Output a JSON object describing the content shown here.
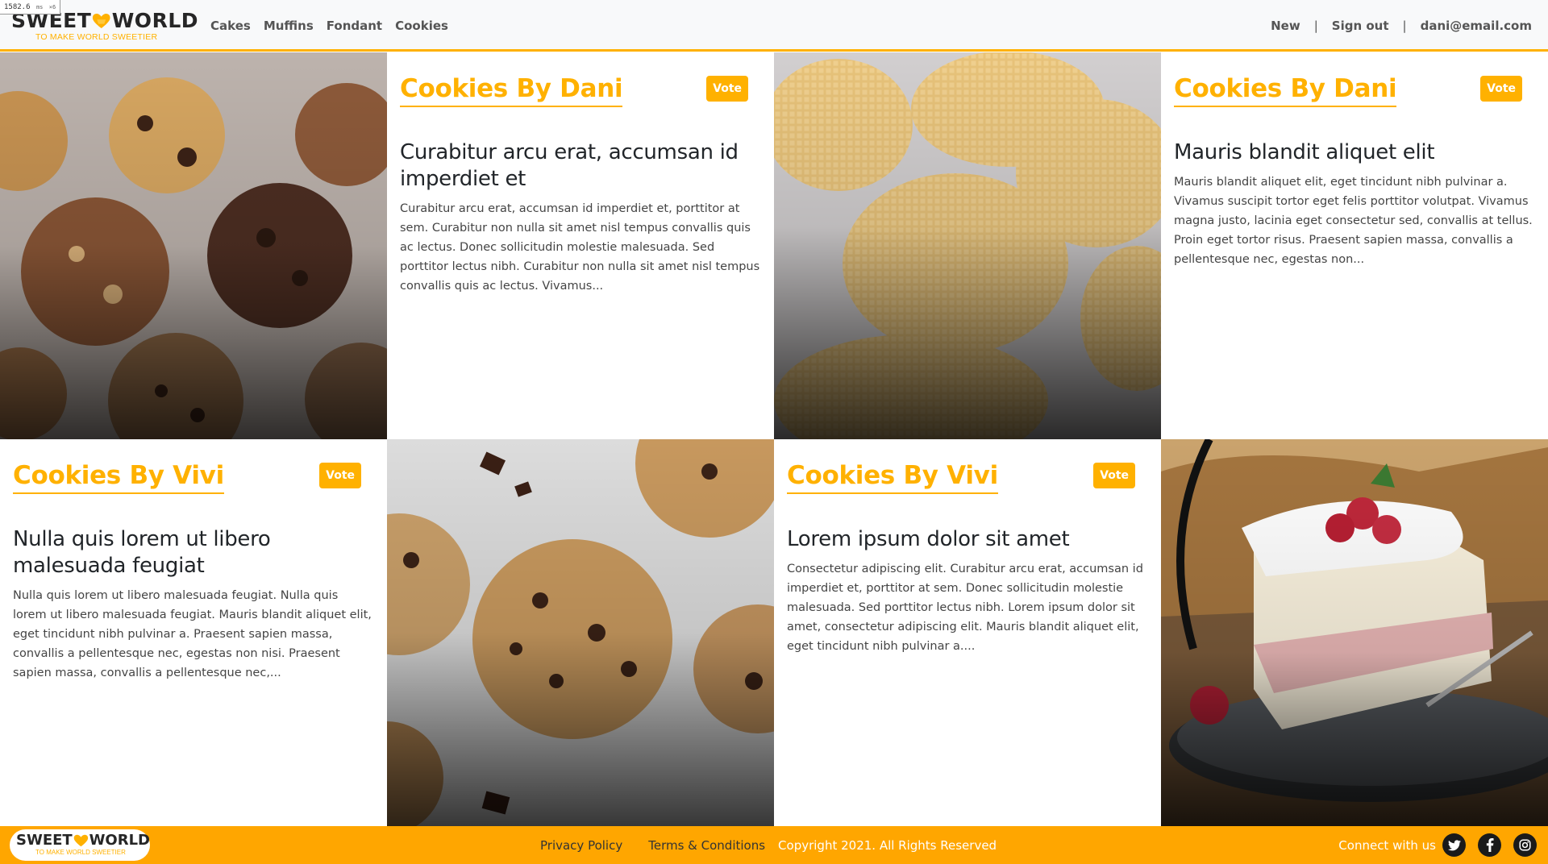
{
  "perf_badge": {
    "value": "1582.6",
    "unit": "ms",
    "multiplier": "×6"
  },
  "brand": {
    "word_left": "SWEET",
    "word_right": "WORLD",
    "tagline": "TO MAKE WORLD SWEETIER",
    "accent_color": "#ffb100"
  },
  "nav": {
    "links": [
      "Cakes",
      "Muffins",
      "Fondant",
      "Cookies"
    ],
    "new_label": "New",
    "separator": "|",
    "signout_label": "Sign out",
    "user_email": "dani@email.com"
  },
  "cards": [
    {
      "title": "Cookies By Dani",
      "vote_label": "Vote",
      "heading": "Curabitur arcu erat, accumsan id imperdiet et",
      "text": "Curabitur arcu erat, accumsan id imperdiet et, porttitor at sem. Curabitur non nulla sit amet nisl tempus convallis quis ac lectus. Donec sollicitudin molestie malesuada. Sed porttitor lectus nibh. Curabitur non nulla sit amet nisl tempus convallis quis ac lectus. Vivamus..."
    },
    {
      "title": "Cookies By Dani",
      "vote_label": "Vote",
      "heading": "Mauris blandit aliquet elit",
      "text": "Mauris blandit aliquet elit, eget tincidunt nibh pulvinar a. Vivamus suscipit tortor eget felis porttitor volutpat. Vivamus magna justo, lacinia eget consectetur sed, convallis at tellus. Proin eget tortor risus. Praesent sapien massa, convallis a pellentesque nec, egestas non..."
    },
    {
      "title": "Cookies By Vivi",
      "vote_label": "Vote",
      "heading": "Nulla quis lorem ut libero malesuada feugiat",
      "text": "Nulla quis lorem ut libero malesuada feugiat. Nulla quis lorem ut libero malesuada feugiat. Mauris blandit aliquet elit, eget tincidunt nibh pulvinar a. Praesent sapien massa, convallis a pellentesque nec, egestas non nisi. Praesent sapien massa, convallis a pellentesque nec,..."
    },
    {
      "title": "Cookies By Vivi",
      "vote_label": "Vote",
      "heading": "Lorem ipsum dolor sit amet",
      "text": "Consectetur adipiscing elit. Curabitur arcu erat, accumsan id imperdiet et, porttitor at sem. Donec sollicitudin molestie malesuada. Sed porttitor lectus nibh. Lorem ipsum dolor sit amet, consectetur adipiscing elit. Mauris blandit aliquet elit, eget tincidunt nibh pulvinar a...."
    }
  ],
  "photos": [
    "assorted-cookies-photo",
    "waffle-cookies-photo",
    "chocolate-chip-cookies-photo",
    "raspberry-cake-photo"
  ],
  "footer": {
    "privacy_label": "Privacy Policy",
    "terms_label": "Terms & Conditions",
    "copyright": "Copyright 2021. All Rights Reserved",
    "connect_label": "Connect with us",
    "social_icons": [
      "twitter-icon",
      "facebook-icon",
      "instagram-icon"
    ],
    "background_color": "#ffa600"
  }
}
